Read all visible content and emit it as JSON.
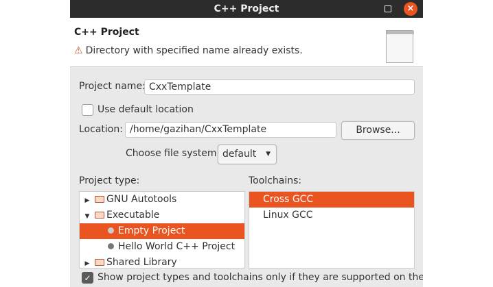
{
  "window": {
    "title": "C++ Project",
    "close_icon": "×"
  },
  "header": {
    "title": "C++ Project",
    "message": "Directory with specified name already exists.",
    "warning_icon": "⚠"
  },
  "form": {
    "project_name_label": "Project name:",
    "project_name_value": "CxxTemplate",
    "use_default_location_label": "Use default location",
    "use_default_location_checked": false,
    "location_label": "Location:",
    "location_value": "/home/gazihan/CxxTemplate",
    "browse_label": "Browse...",
    "file_system_label": "Choose file system:",
    "file_system_value": "default"
  },
  "project_type": {
    "label": "Project type:",
    "items": [
      {
        "label": "GNU Autotools",
        "kind": "folder",
        "state": "collapsed"
      },
      {
        "label": "Executable",
        "kind": "folder",
        "state": "expanded"
      },
      {
        "label": "Empty Project",
        "kind": "item",
        "selected": true
      },
      {
        "label": "Hello World C++ Project",
        "kind": "item"
      },
      {
        "label": "Shared Library",
        "kind": "folder",
        "state": "collapsed"
      }
    ]
  },
  "toolchains": {
    "label": "Toolchains:",
    "items": [
      {
        "label": "Cross GCC",
        "selected": true
      },
      {
        "label": "Linux GCC"
      }
    ]
  },
  "footer": {
    "show_supported_label": "Show project types and toolchains only if they are supported on the pl",
    "checked": true,
    "check_icon": "✓"
  },
  "colors": {
    "accent": "#e95420",
    "titlebar": "#2c2c2c"
  }
}
